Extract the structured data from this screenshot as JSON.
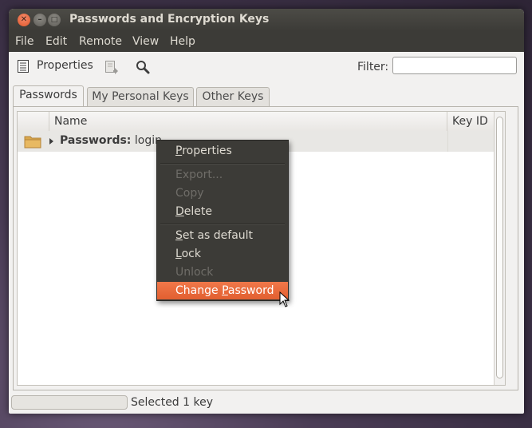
{
  "window": {
    "title": "Passwords and Encryption Keys"
  },
  "menubar": {
    "items": [
      "File",
      "Edit",
      "Remote",
      "View",
      "Help"
    ]
  },
  "toolbar": {
    "properties_label": "Properties"
  },
  "filter": {
    "label": "Filter:",
    "value": ""
  },
  "tabs": [
    "Passwords",
    "My Personal Keys",
    "Other Keys"
  ],
  "table": {
    "columns": [
      "Name",
      "Key ID"
    ],
    "rows": [
      {
        "name_bold": "Passwords:",
        "name_rest": " login",
        "key_id": ""
      }
    ]
  },
  "context_menu": {
    "items": [
      {
        "label": "Properties",
        "underline": "P",
        "rest": "roperties",
        "enabled": true
      },
      {
        "label": "Export...",
        "enabled": false
      },
      {
        "label": "Copy",
        "enabled": false
      },
      {
        "label": "Delete",
        "underline": "D",
        "rest": "elete",
        "enabled": true
      },
      {
        "label": "Set as default",
        "underline": "S",
        "rest": "et as default",
        "enabled": true
      },
      {
        "label": "Lock",
        "underline": "L",
        "rest": "ock",
        "enabled": true
      },
      {
        "label": "Unlock",
        "enabled": false
      },
      {
        "label": "Change Password",
        "before": "Change ",
        "underline": "P",
        "rest": "assword",
        "enabled": true,
        "highlighted": true
      }
    ]
  },
  "status": {
    "text": "Selected 1 key"
  },
  "colors": {
    "highlight": "#e8653a",
    "menu_bg": "#3c3b37"
  }
}
